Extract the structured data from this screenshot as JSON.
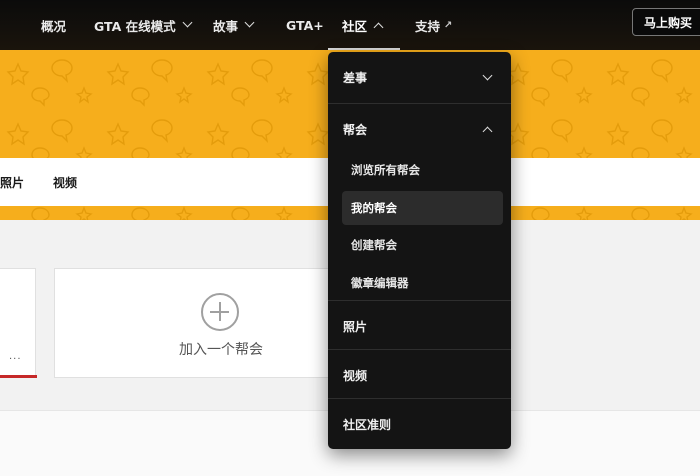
{
  "nav": {
    "items": [
      {
        "label": "概况"
      },
      {
        "label": "GTA 在线模式"
      },
      {
        "label": "故事"
      },
      {
        "label": "GTA+"
      },
      {
        "label": "社区"
      },
      {
        "label": "支持"
      }
    ],
    "buy_label": "马上购买"
  },
  "tabs": {
    "photos": "照片",
    "videos": "视频"
  },
  "content": {
    "join_crew_label": "加入一个帮会",
    "card_dots": "..."
  },
  "dropdown": {
    "heists": "差事",
    "crews": "帮会",
    "crew_items": [
      {
        "label": "浏览所有帮会"
      },
      {
        "label": "我的帮会"
      },
      {
        "label": "创建帮会"
      },
      {
        "label": "徽章编辑器"
      }
    ],
    "photos": "照片",
    "videos": "视频",
    "guidelines": "社区准则"
  },
  "colors": {
    "banner": "#f6ae1c",
    "nav_bg": "#0b0b0b",
    "dropdown_bg": "#141414",
    "accent_red": "#c62828"
  },
  "icons": [
    "chevron-down-icon",
    "chevron-up-icon",
    "external-link-icon",
    "add-circle-icon"
  ]
}
